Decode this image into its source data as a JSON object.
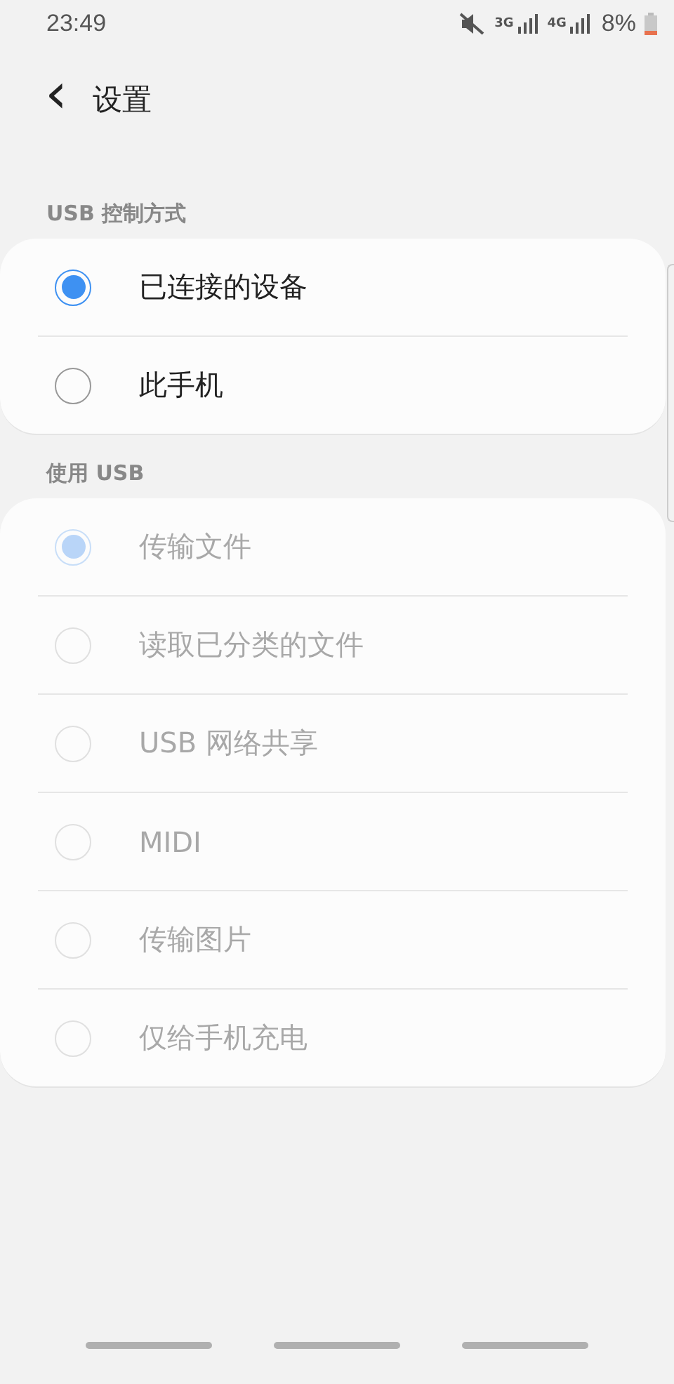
{
  "status_bar": {
    "time": "23:49",
    "network_1": "3G",
    "network_2": "4G",
    "battery": "8%"
  },
  "header": {
    "back": "‹",
    "title": "设置"
  },
  "sections": [
    {
      "title": "USB 控制方式",
      "disabled": false,
      "options": [
        {
          "label": "已连接的设备",
          "selected": true
        },
        {
          "label": "此手机",
          "selected": false
        }
      ]
    },
    {
      "title": "使用 USB",
      "disabled": true,
      "options": [
        {
          "label": "传输文件",
          "selected": true
        },
        {
          "label": "读取已分类的文件",
          "selected": false
        },
        {
          "label": "USB 网络共享",
          "selected": false
        },
        {
          "label": "MIDI",
          "selected": false
        },
        {
          "label": "传输图片",
          "selected": false
        },
        {
          "label": "仅给手机充电",
          "selected": false
        }
      ]
    }
  ]
}
